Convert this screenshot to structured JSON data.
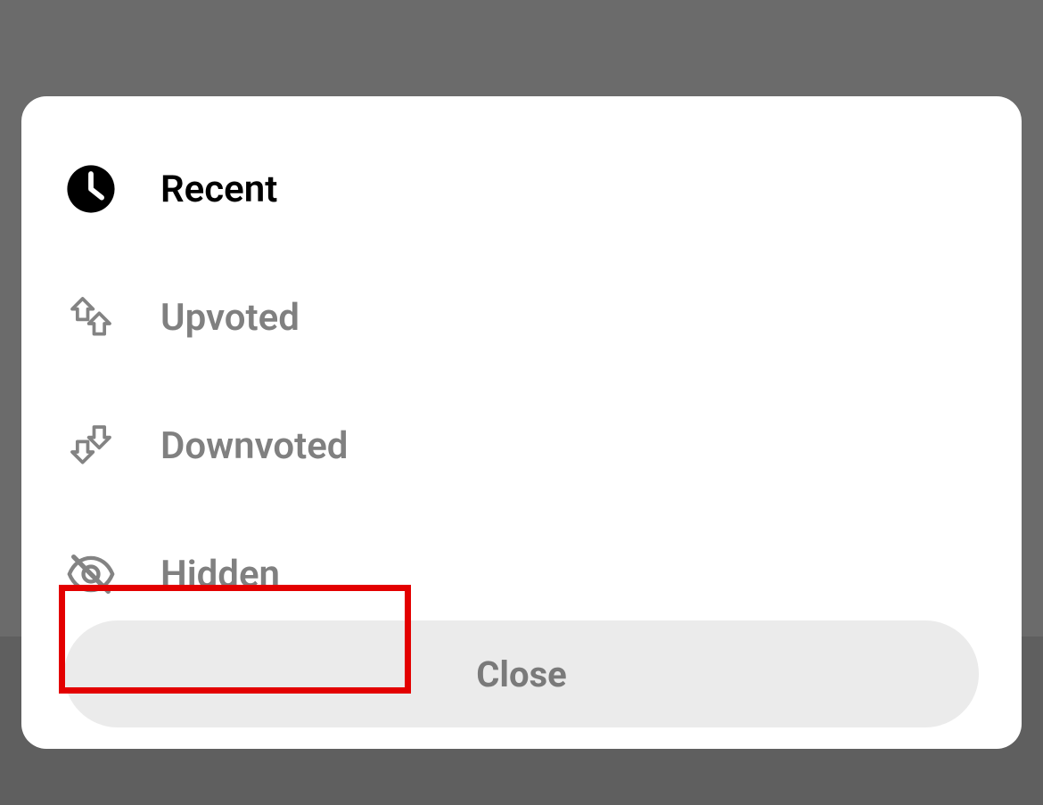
{
  "menu": {
    "items": [
      {
        "label": "Recent",
        "selected": true
      },
      {
        "label": "Upvoted",
        "selected": false
      },
      {
        "label": "Downvoted",
        "selected": false
      },
      {
        "label": "Hidden",
        "selected": false
      }
    ],
    "close_label": "Close"
  },
  "highlight": {
    "target_index": 3
  }
}
